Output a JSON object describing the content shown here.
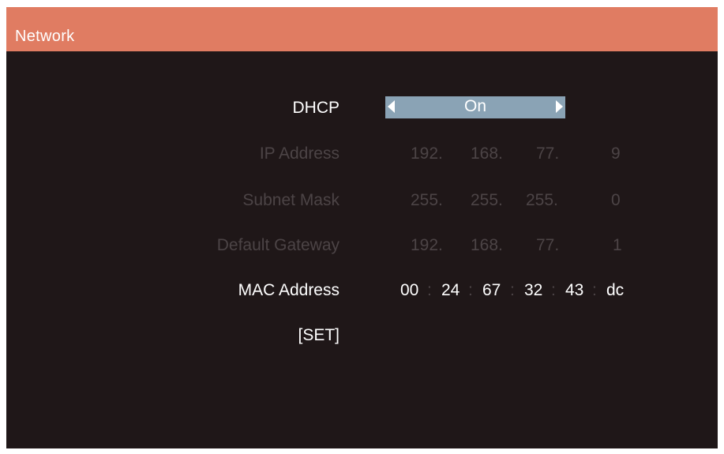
{
  "window": {
    "title": "Network"
  },
  "dhcp": {
    "label": "DHCP",
    "value": "On"
  },
  "ip_address": {
    "label": "IP Address",
    "octets": [
      "192.",
      "168.",
      "77.",
      "9"
    ]
  },
  "subnet_mask": {
    "label": "Subnet Mask",
    "octets": [
      "255.",
      "255.",
      "255.",
      "0"
    ]
  },
  "default_gateway": {
    "label": "Default Gateway",
    "octets": [
      "192.",
      "168.",
      "77.",
      "1"
    ]
  },
  "mac_address": {
    "label": "MAC Address",
    "bytes": [
      "00",
      "24",
      "67",
      "32",
      "43",
      "dc"
    ],
    "separator": ":"
  },
  "set_button": {
    "label": "[SET]"
  },
  "colors": {
    "titlebar": "#e07c62",
    "background": "#1f1718",
    "selector": "#8aa3b5",
    "enabled_text": "#ffffff",
    "disabled_text": "#4c4446"
  }
}
